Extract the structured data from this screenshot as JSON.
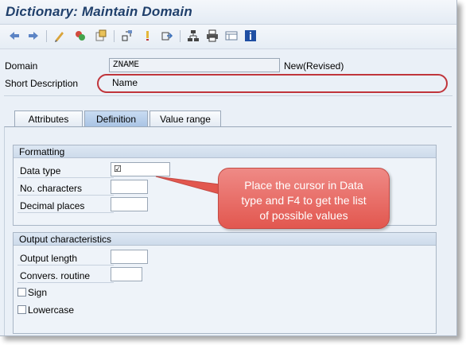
{
  "window": {
    "title": "Dictionary: Maintain Domain"
  },
  "toolbar": {
    "icons": [
      "back-icon",
      "forward-icon",
      "display-change-icon",
      "activate-icon",
      "check-icon",
      "where-used-icon",
      "info-icon",
      "navigation-icon",
      "hierarchy-icon",
      "print-icon",
      "layout-icon",
      "help-icon"
    ]
  },
  "header": {
    "domain_label": "Domain",
    "domain_value": "ZNAME",
    "domain_status": "New(Revised)",
    "short_desc_label": "Short Description",
    "short_desc_value": "Name"
  },
  "tabs": [
    {
      "label": "Attributes",
      "active": false
    },
    {
      "label": "Definition",
      "active": true
    },
    {
      "label": "Value range",
      "active": false
    }
  ],
  "formatting": {
    "title": "Formatting",
    "data_type_label": "Data type",
    "no_characters_label": "No. characters",
    "decimal_places_label": "Decimal places"
  },
  "output": {
    "title": "Output characteristics",
    "output_length_label": "Output length",
    "convers_routine_label": "Convers. routine",
    "sign_label": "Sign",
    "lowercase_label": "Lowercase"
  },
  "callout": {
    "line1": "Place the cursor in Data",
    "line2": "type and F4 to get the list",
    "line3": "of possible values"
  },
  "colors": {
    "accent_red": "#e2574f",
    "title_blue": "#1f3f6b"
  }
}
